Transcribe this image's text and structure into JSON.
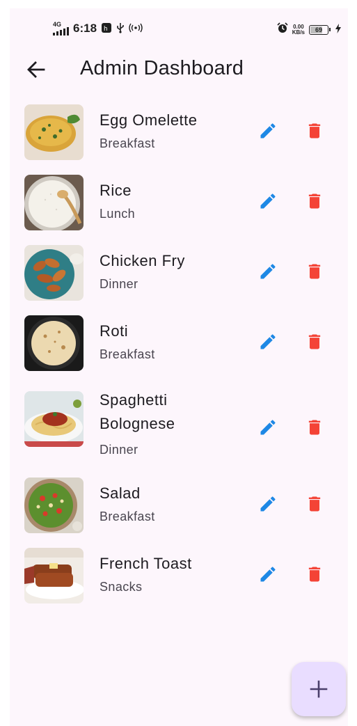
{
  "status_bar": {
    "network": "4G",
    "time": "6:18",
    "speed_value": "0.00",
    "speed_unit": "KB/s",
    "battery_level": "69"
  },
  "app_bar": {
    "title": "Admin Dashboard",
    "back_icon": "arrow-back-icon"
  },
  "colors": {
    "background": "#fdf6fc",
    "edit": "#1e88e5",
    "delete": "#f44336",
    "fab": "#e9ddff",
    "fab_icon": "#4a3f6b"
  },
  "items": [
    {
      "name": "Egg Omelette",
      "category": "Breakfast"
    },
    {
      "name": "Rice",
      "category": "Lunch"
    },
    {
      "name": "Chicken Fry",
      "category": "Dinner"
    },
    {
      "name": "Roti",
      "category": "Breakfast"
    },
    {
      "name": "Spaghetti Bolognese",
      "name_line1": "Spaghetti",
      "name_line2": "Bolognese",
      "category": "Dinner"
    },
    {
      "name": "Salad",
      "category": "Breakfast"
    },
    {
      "name": "French Toast",
      "category": "Snacks"
    }
  ],
  "icons": {
    "edit": "pencil-icon",
    "delete": "trash-icon",
    "add": "plus-icon"
  }
}
